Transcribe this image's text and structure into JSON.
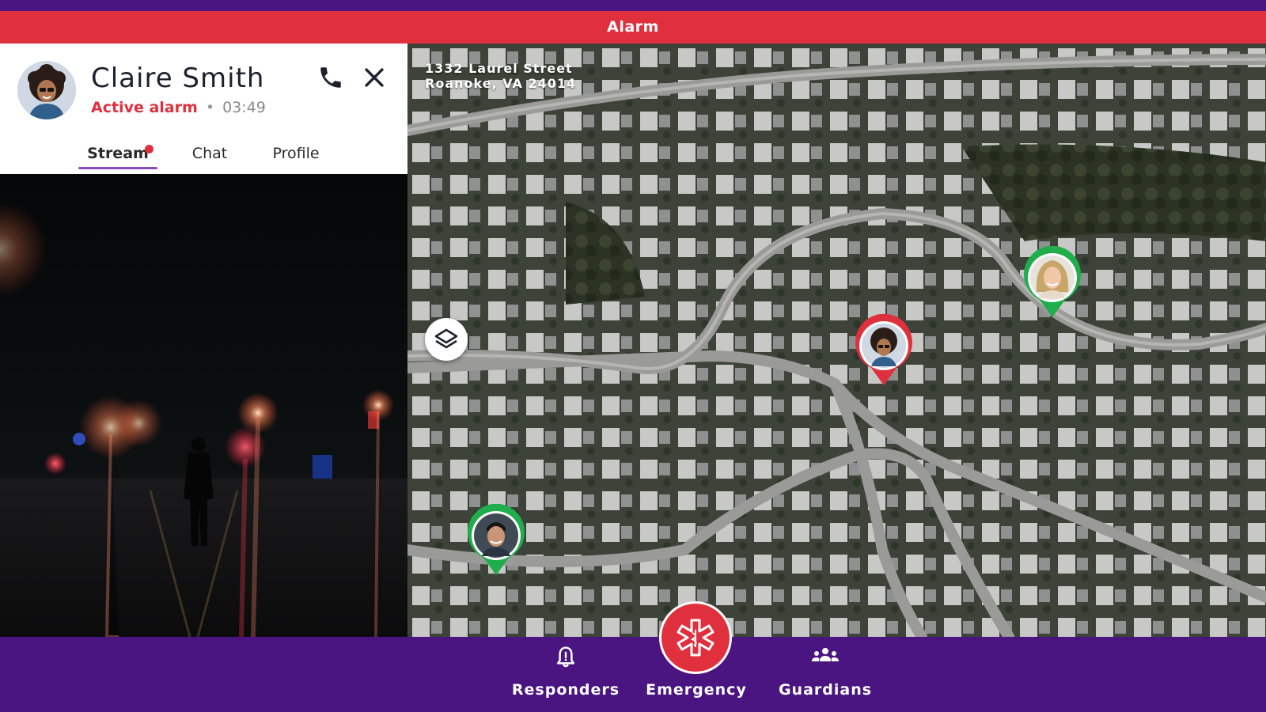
{
  "header": {
    "title": "Alarm"
  },
  "user": {
    "name": "Claire Smith",
    "status": "Active alarm",
    "separator": "•",
    "elapsed": "03:49"
  },
  "tabs": [
    {
      "label": "Stream",
      "active": true,
      "has_notification": true
    },
    {
      "label": "Chat",
      "active": false
    },
    {
      "label": "Profile",
      "active": false
    }
  ],
  "map": {
    "address_line1": "1332 Laurel Street",
    "address_line2": "Roanoke, VA 24014",
    "pins": [
      {
        "name": "Claire Smith",
        "type": "alarm",
        "color": "#e0303e"
      },
      {
        "name": "responder-woman",
        "type": "guardian",
        "color": "#1fae4b"
      },
      {
        "name": "responder-man",
        "type": "guardian",
        "color": "#1fae4b"
      }
    ]
  },
  "nav": {
    "responders_label": "Responders",
    "emergency_label": "Emergency",
    "guardians_label": "Guardians"
  },
  "colors": {
    "brand_purple": "#4a1580",
    "alarm_red": "#e0303e",
    "guardian_green": "#1fae4b",
    "tab_underline": "#8a4bbf"
  },
  "icons": [
    "phone-icon",
    "close-icon",
    "layers-icon",
    "bell-alert-icon",
    "medical-star-icon",
    "group-icon"
  ]
}
